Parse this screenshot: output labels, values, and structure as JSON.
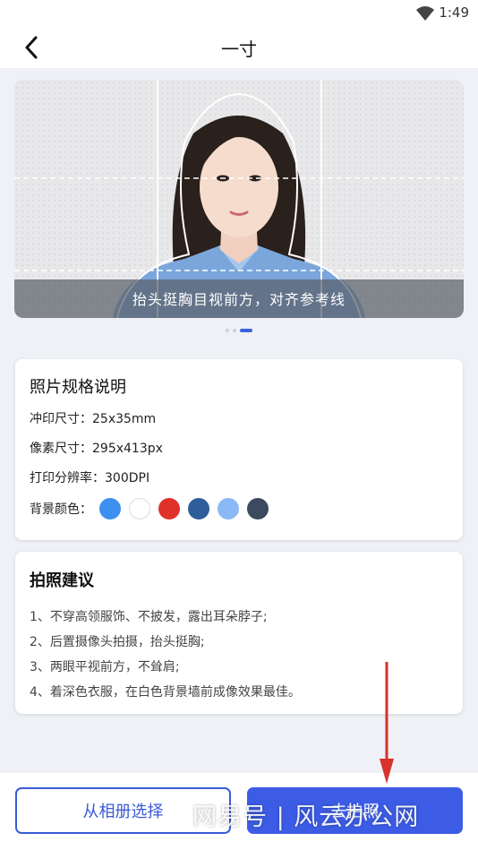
{
  "status_bar": {
    "time": "1:49",
    "signal_icon": "wifi-signal-icon"
  },
  "nav": {
    "back_icon": "chevron-left-icon",
    "title": "一寸"
  },
  "banner": {
    "caption": "抬头挺胸目视前方，对齐参考线",
    "carousel_total": 3,
    "carousel_active": 3
  },
  "spec_card": {
    "title": "照片规格说明",
    "print_size": "冲印尺寸：25x35mm",
    "pixel_size": "像素尺寸：295x413px",
    "resolution": "打印分辨率：300DPI",
    "bg_label": "背景颜色：",
    "bg_colors": [
      "#3d8ff0",
      "#ffffff",
      "#e03128",
      "#2f5d9a",
      "#8ab9f5",
      "#3b4a5e"
    ]
  },
  "tips_card": {
    "title": "拍照建议",
    "tips": [
      "1、不穿高领服饰、不披发，露出耳朵脖子;",
      "2、后置摄像头拍摄，抬头挺胸;",
      "3、两眼平视前方，不耸肩;",
      "4、着深色衣服，在白色背景墙前成像效果最佳。"
    ]
  },
  "bottom": {
    "album_button": "从相册选择",
    "shoot_button": "去拍照"
  },
  "watermark": "网易号 | 风云办公网",
  "colors": {
    "accent": "#3c5ce6",
    "annotation_arrow": "#d9312b"
  }
}
